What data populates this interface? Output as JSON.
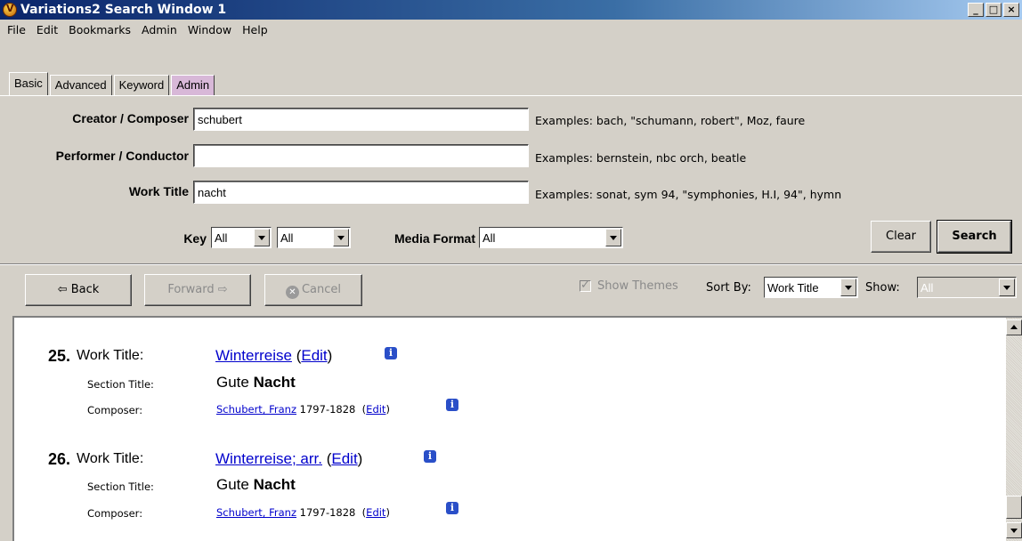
{
  "window": {
    "title": "Variations2 Search Window 1",
    "controls": [
      "_",
      "□",
      "×"
    ]
  },
  "menu": [
    {
      "label": "File"
    },
    {
      "label": "Edit"
    },
    {
      "label": "Bookmarks"
    },
    {
      "label": "Admin"
    },
    {
      "label": "Window"
    },
    {
      "label": "Help"
    }
  ],
  "tabs": [
    {
      "label": "Basic",
      "active": true
    },
    {
      "label": "Advanced"
    },
    {
      "label": "Keyword"
    },
    {
      "label": "Admin"
    }
  ],
  "form": {
    "creator": {
      "label": "Creator / Composer",
      "value": "schubert",
      "example": "Examples: bach, \"schumann, robert\", Moz, faure"
    },
    "performer": {
      "label": "Performer / Conductor",
      "value": "",
      "example": "Examples: bernstein, nbc orch, beatle"
    },
    "work_title": {
      "label": "Work Title",
      "value": "nacht",
      "example": "Examples: sonat, sym 94, \"symphonies, H.I, 94\", hymn"
    },
    "key_label": "Key",
    "key_value_1": "All",
    "key_value_2": "All",
    "media_label": "Media Format",
    "media_value": "All",
    "clear_label": "Clear",
    "search_label": "Search"
  },
  "nav": {
    "back_label": "⇦ Back",
    "forward_label": "Forward ⇨",
    "cancel_label": "Cancel",
    "cancel_icon": "✕",
    "show_themes_label": "Show Themes",
    "sort_by_label": "Sort By:",
    "sort_by_value": "Work Title",
    "show_label": "Show:",
    "show_value": "All"
  },
  "results": [
    {
      "num": "25.",
      "work_title_label": "Work Title:",
      "work_title": "Winterreise",
      "edit": "Edit",
      "section_label": "Section Title:",
      "section_plain": "Gute",
      "section_bold": "Nacht",
      "composer_label": "Composer:",
      "composer": "Schubert, Franz",
      "dates": "1797-1828",
      "composer_edit": "Edit"
    },
    {
      "num": "26.",
      "work_title_label": "Work Title:",
      "work_title": "Winterreise; arr.",
      "edit": "Edit",
      "section_label": "Section Title:",
      "section_plain": "Gute",
      "section_bold": "Nacht",
      "composer_label": "Composer:",
      "composer": "Schubert, Franz",
      "dates": "1797-1828",
      "composer_edit": "Edit"
    }
  ],
  "info_icon": "i"
}
